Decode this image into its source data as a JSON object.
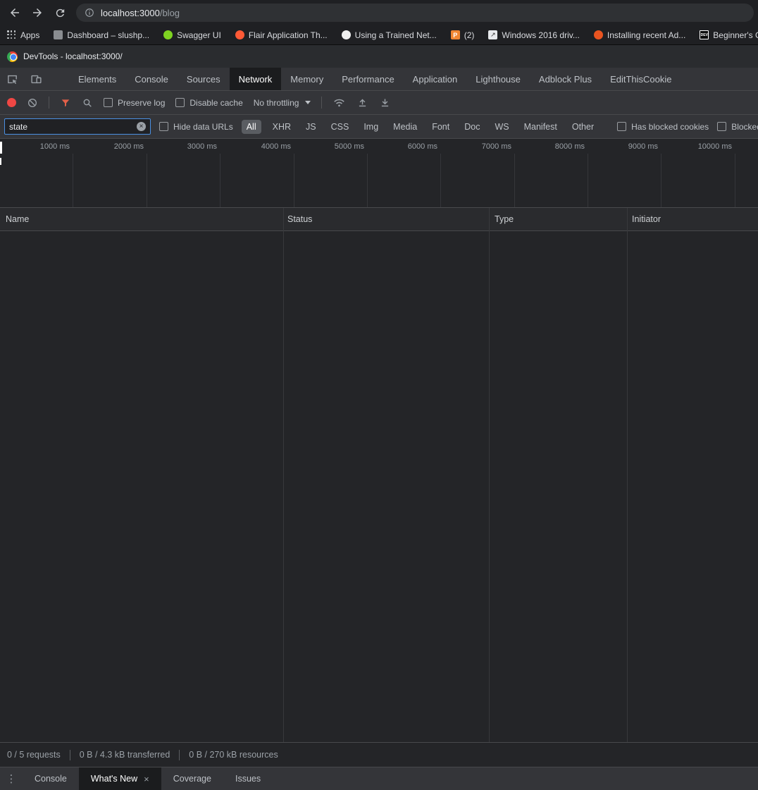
{
  "colors": {
    "record_red": "#f04744",
    "filter_red": "#e36049",
    "focus_blue": "#4a90e2"
  },
  "browser": {
    "url_host": "localhost:3000",
    "url_path": "/blog",
    "apps_label": "Apps",
    "bookmarks": [
      {
        "label": "Dashboard – slushp...",
        "icon": "generic-favicon"
      },
      {
        "label": "Swagger UI",
        "icon": "swagger-favicon"
      },
      {
        "label": "Flair Application Th...",
        "icon": "flair-favicon"
      },
      {
        "label": "Using a Trained Net...",
        "icon": "github-favicon"
      },
      {
        "label": "(2)",
        "icon": "postman-favicon"
      },
      {
        "label": "Windows 2016 driv...",
        "icon": "windows-favicon"
      },
      {
        "label": "Installing recent Ad...",
        "icon": "ubuntu-favicon"
      },
      {
        "label": "Beginner's G",
        "icon": "dev-favicon"
      }
    ]
  },
  "devtools": {
    "window_title": "DevTools - localhost:3000/",
    "tabs": [
      "Elements",
      "Console",
      "Sources",
      "Network",
      "Memory",
      "Performance",
      "Application",
      "Lighthouse",
      "Adblock Plus",
      "EditThisCookie"
    ],
    "selected_tab": "Network",
    "toolbar": {
      "preserve_log": "Preserve log",
      "disable_cache": "Disable cache",
      "throttling": "No throttling"
    },
    "filter": {
      "value": "state",
      "hide_data_urls": "Hide data URLs",
      "types": [
        "All",
        "XHR",
        "JS",
        "CSS",
        "Img",
        "Media",
        "Font",
        "Doc",
        "WS",
        "Manifest",
        "Other"
      ],
      "selected_type": "All",
      "has_blocked_cookies": "Has blocked cookies",
      "blocked_requests": "Blocked"
    },
    "timeline": {
      "ticks": [
        "1000 ms",
        "2000 ms",
        "3000 ms",
        "4000 ms",
        "5000 ms",
        "6000 ms",
        "7000 ms",
        "8000 ms",
        "9000 ms",
        "10000 ms"
      ]
    },
    "table": {
      "columns": [
        "Name",
        "Status",
        "Type",
        "Initiator"
      ]
    },
    "status_bar": {
      "requests": "0 / 5 requests",
      "transferred": "0 B / 4.3 kB transferred",
      "resources": "0 B / 270 kB resources"
    },
    "drawer": {
      "tabs": [
        "Console",
        "What's New",
        "Coverage",
        "Issues"
      ],
      "selected_tab": "What's New"
    }
  }
}
